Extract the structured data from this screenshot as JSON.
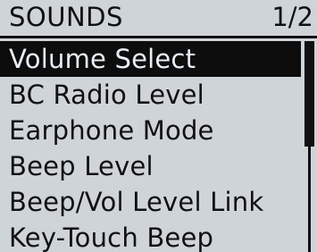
{
  "header": {
    "title": "SOUNDS",
    "page_indicator": "1/2"
  },
  "menu": {
    "items": [
      {
        "label": "Volume Select",
        "selected": true
      },
      {
        "label": "BC Radio Level",
        "selected": false
      },
      {
        "label": "Earphone Mode",
        "selected": false
      },
      {
        "label": "Beep Level",
        "selected": false
      },
      {
        "label": "Beep/Vol Level Link",
        "selected": false
      },
      {
        "label": "Key-Touch Beep",
        "selected": false
      }
    ]
  },
  "scrollbar": {
    "visible_fraction": 0.5,
    "position_fraction": 0.0
  },
  "colors": {
    "screen_background": "#cfd4d9",
    "text": "#111111",
    "selected_background": "#0d0d0d",
    "selected_text": "#e8eef5"
  }
}
